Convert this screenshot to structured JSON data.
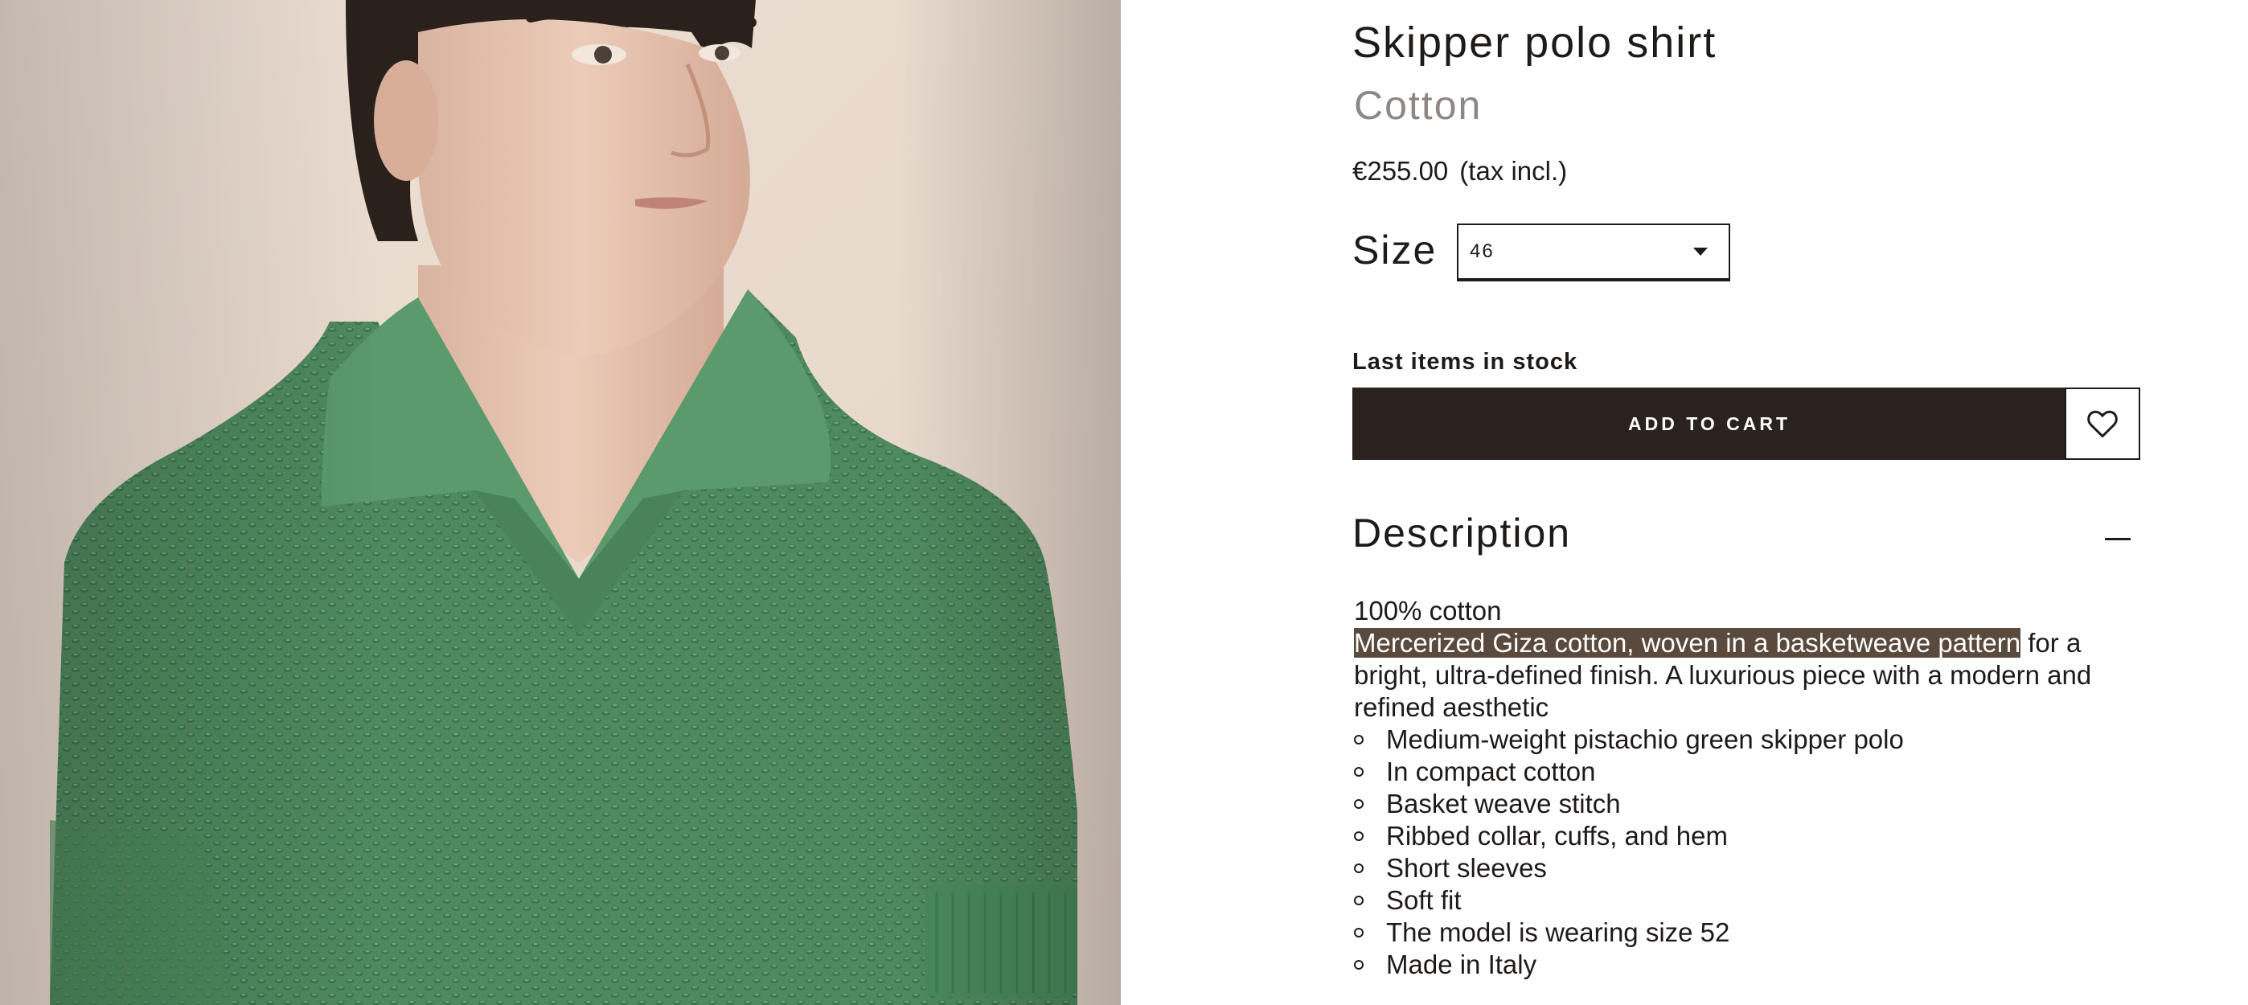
{
  "product": {
    "title": "Skipper polo shirt",
    "material": "Cotton",
    "price": "€255.00",
    "tax_note": "(tax incl.)",
    "image_alt": "Model wearing green knitted skipper polo shirt"
  },
  "size": {
    "label": "Size",
    "selected": "46"
  },
  "stock_status": "Last items in stock",
  "actions": {
    "add_to_cart": "ADD TO CART",
    "wishlist_icon": "heart-icon"
  },
  "description": {
    "heading": "Description",
    "toggle_icon": "minus-icon",
    "composition": "100% cotton",
    "highlighted_text": "Mercerized Giza cotton, woven in a basketweave pattern",
    "body_text": " for a bright, ultra-defined finish. A luxurious piece with a modern and refined aesthetic",
    "features": [
      "Medium-weight pistachio green skipper polo",
      "In compact cotton",
      "Basket weave stitch",
      "Ribbed collar, cuffs, and hem",
      "Short sleeves",
      "Soft fit",
      "The model is wearing size 52",
      "Made in Italy"
    ]
  },
  "colors": {
    "button_bg": "#2b211e",
    "highlight_bg": "#5a4a3e",
    "shirt_green": "#4f8a5e",
    "text": "#1e1a18",
    "muted_text": "#8d8682"
  }
}
